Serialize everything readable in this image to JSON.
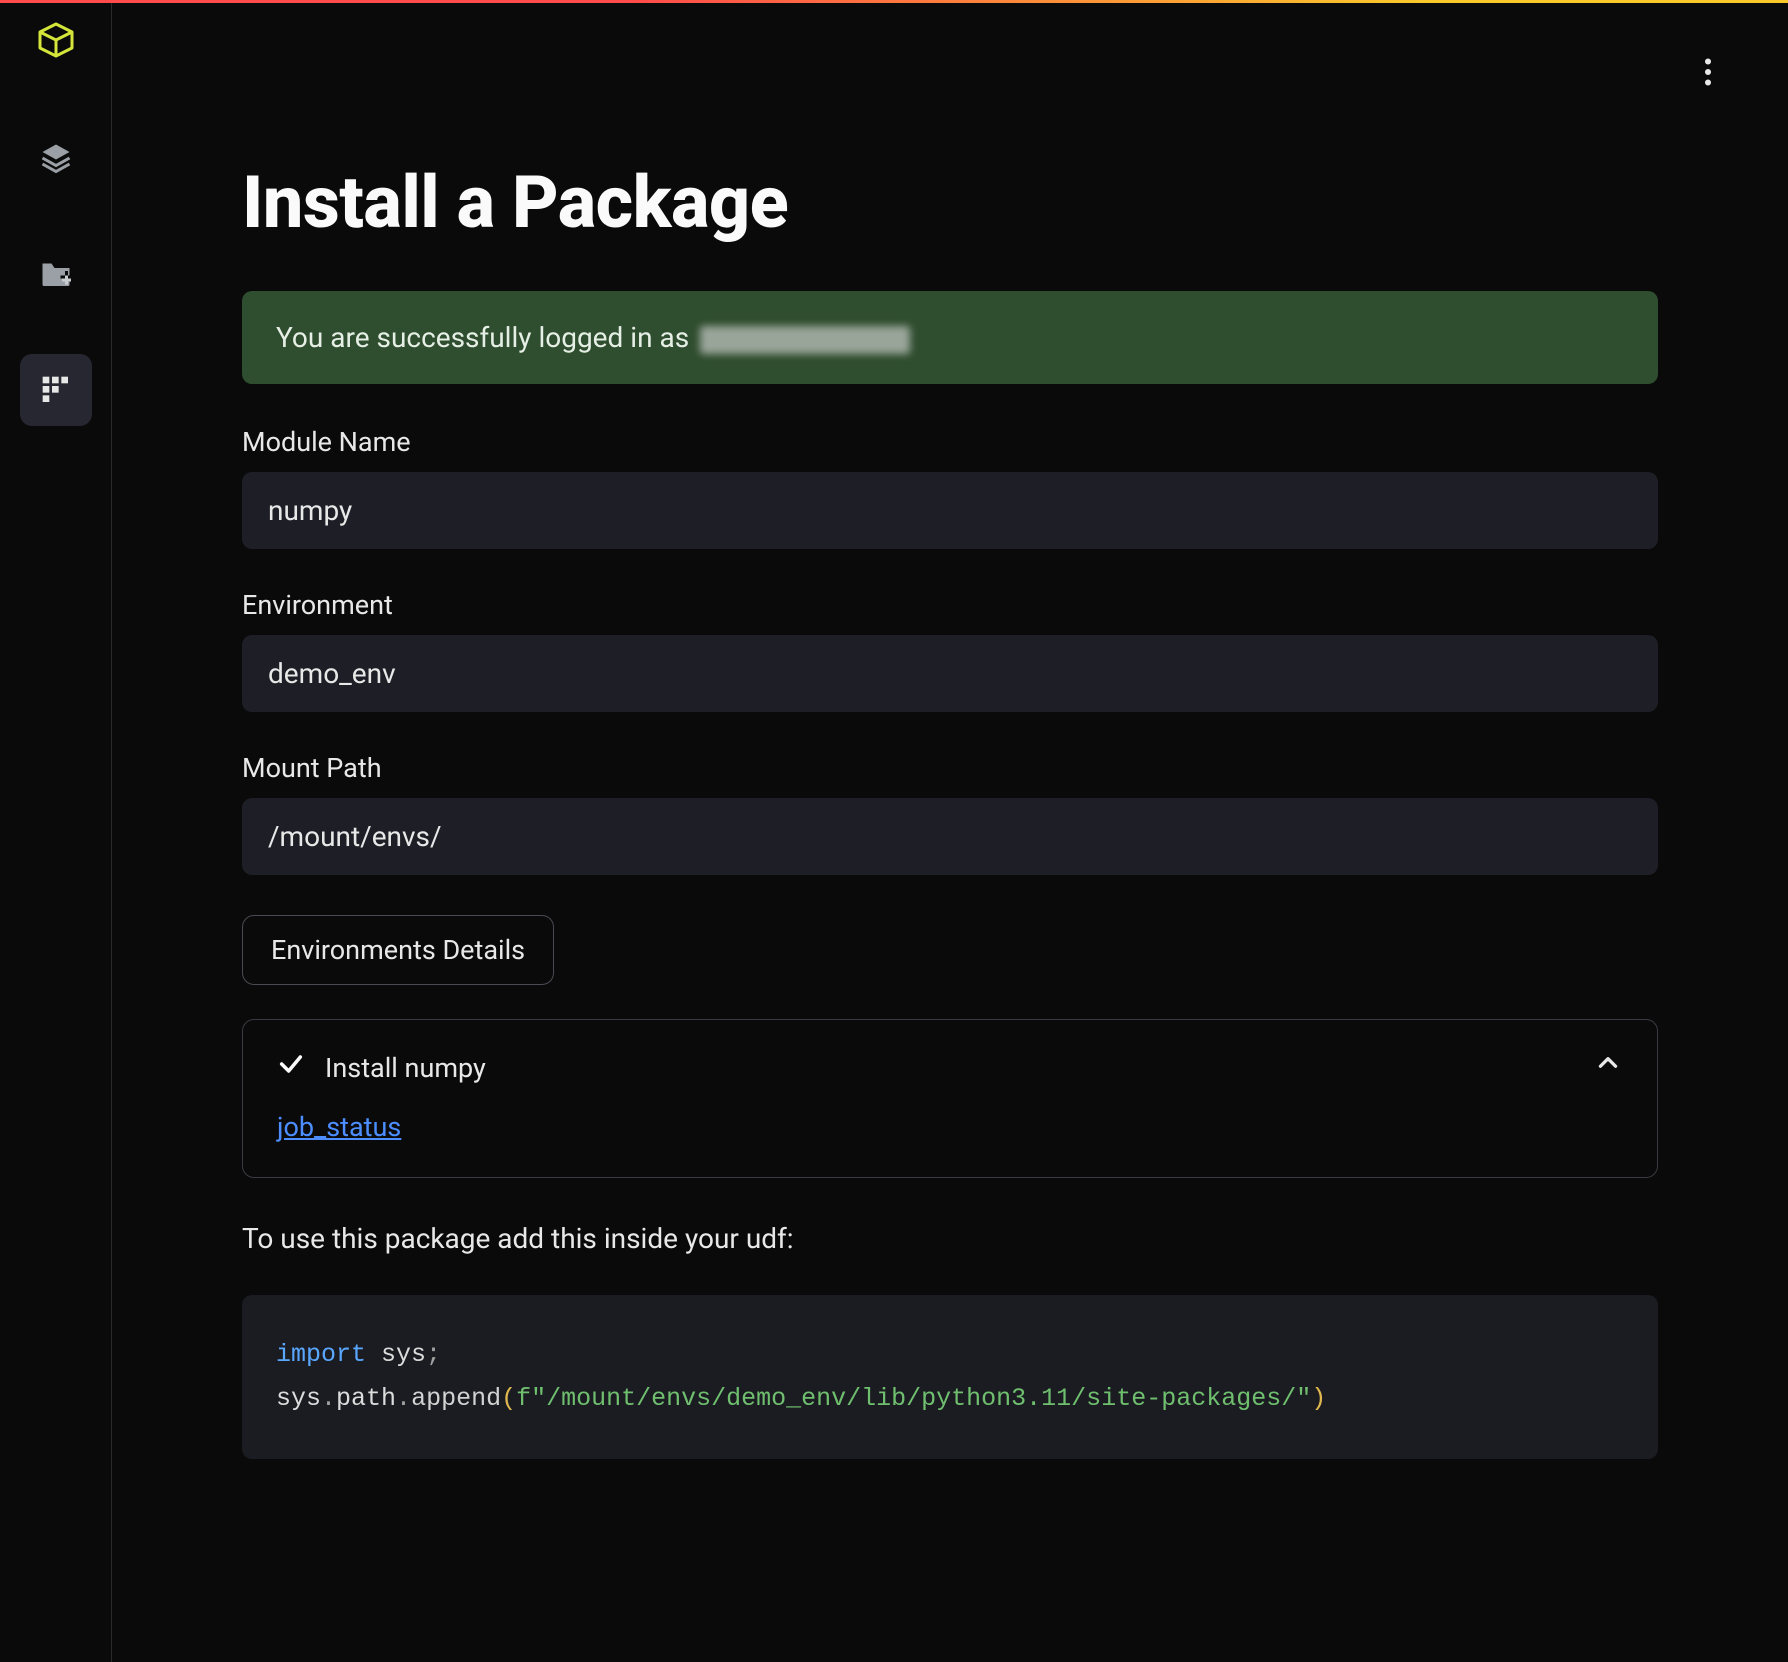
{
  "page": {
    "title": "Install a Package",
    "banner_prefix": "You are successfully logged in as ",
    "hint": "To use this package add this inside your udf:"
  },
  "fields": {
    "module_name": {
      "label": "Module Name",
      "value": "numpy"
    },
    "environment": {
      "label": "Environment",
      "value": "demo_env"
    },
    "mount_path": {
      "label": "Mount Path",
      "value": "/mount/envs/"
    }
  },
  "buttons": {
    "env_details": "Environments Details"
  },
  "status": {
    "label": "Install numpy",
    "link_text": "job_status"
  },
  "code": {
    "kw_import": "import",
    "sys": " sys",
    "semi": ";",
    "line2_a": "sys",
    "dot": ".",
    "line2_b": "path",
    "line2_c": "append",
    "lparen": "(",
    "str": "f\"/mount/envs/demo_env/lib/python3.11/site-packages/\"",
    "rparen": ")"
  },
  "icons": {
    "logo": "cube-logo",
    "nav1": "layers-icon",
    "nav2": "folder-plus-icon",
    "nav3": "grid-icon",
    "kebab": "more-vertical-icon",
    "check": "check-icon",
    "chevron": "chevron-up-icon"
  }
}
